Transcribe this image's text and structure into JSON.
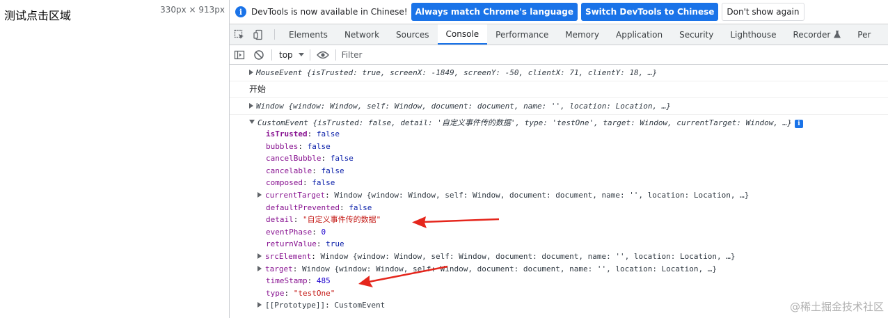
{
  "page": {
    "click_area_text": "测试点击区域",
    "viewport_size": "330px × 913px"
  },
  "infobar": {
    "icon": "info-icon",
    "message": "DevTools is now available in Chinese!",
    "btn_match": "Always match Chrome's language",
    "btn_switch": "Switch DevTools to Chinese",
    "btn_dismiss": "Don't show again"
  },
  "tabs": [
    {
      "label": "Elements"
    },
    {
      "label": "Network"
    },
    {
      "label": "Sources"
    },
    {
      "label": "Console"
    },
    {
      "label": "Performance"
    },
    {
      "label": "Memory"
    },
    {
      "label": "Application"
    },
    {
      "label": "Security"
    },
    {
      "label": "Lighthouse"
    },
    {
      "label": "Recorder"
    },
    {
      "label": "Per"
    }
  ],
  "toolbar": {
    "context": "top",
    "filter_placeholder": "Filter"
  },
  "console": {
    "mouse_event": {
      "name": "MouseEvent",
      "preview": "{isTrusted: true, screenX: -1849, screenY: -50, clientX: 71, clientY: 18, …}"
    },
    "start_text": "开始",
    "window_line": {
      "name": "Window",
      "preview": "{window: Window, self: Window, document: document, name: '', location: Location, …}"
    },
    "custom_event": {
      "name": "CustomEvent",
      "preview": "{isTrusted: false, detail: '自定义事件传的数据', type: 'testOne', target: Window, currentTarget: Window, …}"
    },
    "props": {
      "isTrusted": "false",
      "bubbles": "false",
      "cancelBubble": "false",
      "cancelable": "false",
      "composed": "false",
      "currentTarget": "Window {window: Window, self: Window, document: document, name: '', location: Location, …}",
      "defaultPrevented": "false",
      "detail": "\"自定义事件传的数据\"",
      "eventPhase": "0",
      "returnValue": "true",
      "srcElement": "Window {window: Window, self: Window, document: document, name: '', location: Location, …}",
      "target": "Window {window: Window, self: Window, document: document, name: '', location: Location, …}",
      "timeStamp": "485",
      "type": "\"testOne\"",
      "prototype": "CustomEvent"
    }
  },
  "watermark": "@稀土掘金技术社区",
  "colors": {
    "accent": "#1a73e8",
    "annotation_arrow": "#e5261c"
  }
}
